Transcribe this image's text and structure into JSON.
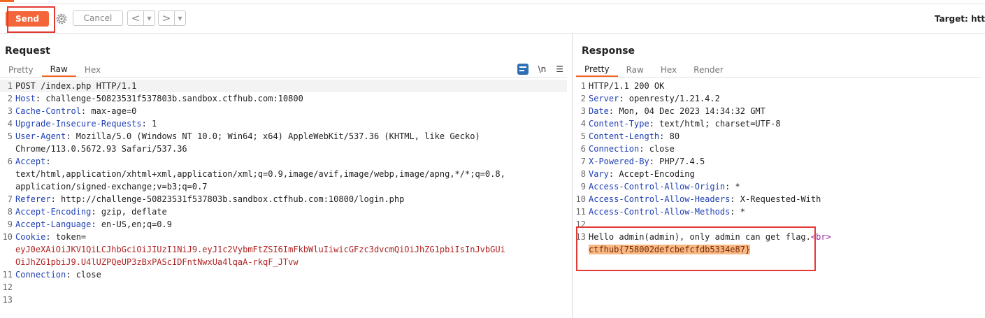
{
  "toolbar": {
    "send_label": "Send",
    "cancel_label": "Cancel",
    "back_glyph": "<",
    "forward_glyph": ">",
    "dropdown_glyph": "▼",
    "target_text": "Target: htt",
    "icons": {
      "settings": "gear-icon"
    }
  },
  "colors": {
    "accent": "#f26522",
    "send_button": "#f4663a",
    "highlight_box": "#e53935",
    "header_key": "#1e3fb4",
    "cookie_value": "#b22323",
    "flag_bg": "#f7b883"
  },
  "request": {
    "title": "Request",
    "tabs": [
      "Pretty",
      "Raw",
      "Hex"
    ],
    "active_tab": "Raw",
    "tools": {
      "wrap_icon": "wrap-lines-icon",
      "newline_label": "\\n",
      "menu_icon": "hamburger-menu-icon"
    },
    "lines": [
      {
        "num": "1",
        "text": "POST /index.php HTTP/1.1"
      },
      {
        "num": "2",
        "key": "Host",
        "value": "challenge-50823531f537803b.sandbox.ctfhub.com:10800"
      },
      {
        "num": "3",
        "key": "Cache-Control",
        "value": "max-age=0"
      },
      {
        "num": "4",
        "key": "Upgrade-Insecure-Requests",
        "value": "1"
      },
      {
        "num": "5",
        "key": "User-Agent",
        "value": "Mozilla/5.0 (Windows NT 10.0; Win64; x64) AppleWebKit/537.36 (KHTML, like Gecko)",
        "cont": [
          "Chrome/113.0.5672.93 Safari/537.36"
        ]
      },
      {
        "num": "6",
        "key": "Accept",
        "value": "",
        "cont": [
          "text/html,application/xhtml+xml,application/xml;q=0.9,image/avif,image/webp,image/apng,*/*;q=0.8,",
          "application/signed-exchange;v=b3;q=0.7"
        ]
      },
      {
        "num": "7",
        "key": "Referer",
        "value": "http://challenge-50823531f537803b.sandbox.ctfhub.com:10800/login.php"
      },
      {
        "num": "8",
        "key": "Accept-Encoding",
        "value": "gzip, deflate"
      },
      {
        "num": "9",
        "key": "Accept-Language",
        "value": "en-US,en;q=0.9"
      },
      {
        "num": "10",
        "key": "Cookie",
        "value": "token=",
        "cookie_cont": [
          "eyJ0eXAiOiJKV1QiLCJhbGciOiJIUzI1NiJ9.eyJ1c2VybmFtZSI6ImFkbWluIiwicGFzc3dvcmQiOiJhZG1pbiIsInJvbGUi",
          "OiJhZG1pbiJ9.U4lUZPQeUP3zBxPAScIDFntNwxUa4lqaA-rkqF_JTvw"
        ]
      },
      {
        "num": "11",
        "key": "Connection",
        "value": "close"
      },
      {
        "num": "12",
        "text": ""
      },
      {
        "num": "13",
        "text": ""
      }
    ]
  },
  "response": {
    "title": "Response",
    "tabs": [
      "Pretty",
      "Raw",
      "Hex",
      "Render"
    ],
    "active_tab": "Pretty",
    "lines": [
      {
        "num": "1",
        "text": "HTTP/1.1 200 OK"
      },
      {
        "num": "2",
        "key": "Server",
        "value": "openresty/1.21.4.2"
      },
      {
        "num": "3",
        "key": "Date",
        "value": "Mon, 04 Dec 2023 14:34:32 GMT"
      },
      {
        "num": "4",
        "key": "Content-Type",
        "value": "text/html; charset=UTF-8"
      },
      {
        "num": "5",
        "key": "Content-Length",
        "value": "80"
      },
      {
        "num": "6",
        "key": "Connection",
        "value": "close"
      },
      {
        "num": "7",
        "key": "X-Powered-By",
        "value": "PHP/7.4.5"
      },
      {
        "num": "8",
        "key": "Vary",
        "value": "Accept-Encoding"
      },
      {
        "num": "9",
        "key": "Access-Control-Allow-Origin",
        "value": "*"
      },
      {
        "num": "10",
        "key": "Access-Control-Allow-Headers",
        "value": "X-Requested-With"
      },
      {
        "num": "11",
        "key": "Access-Control-Allow-Methods",
        "value": "*"
      },
      {
        "num": "12",
        "text": ""
      },
      {
        "num": "13",
        "body_text": "Hello admin(admin), only admin can get flag.",
        "body_tag": "<br>",
        "flag": "ctfhub{758002defcbefcfdb5334e87}"
      }
    ]
  }
}
